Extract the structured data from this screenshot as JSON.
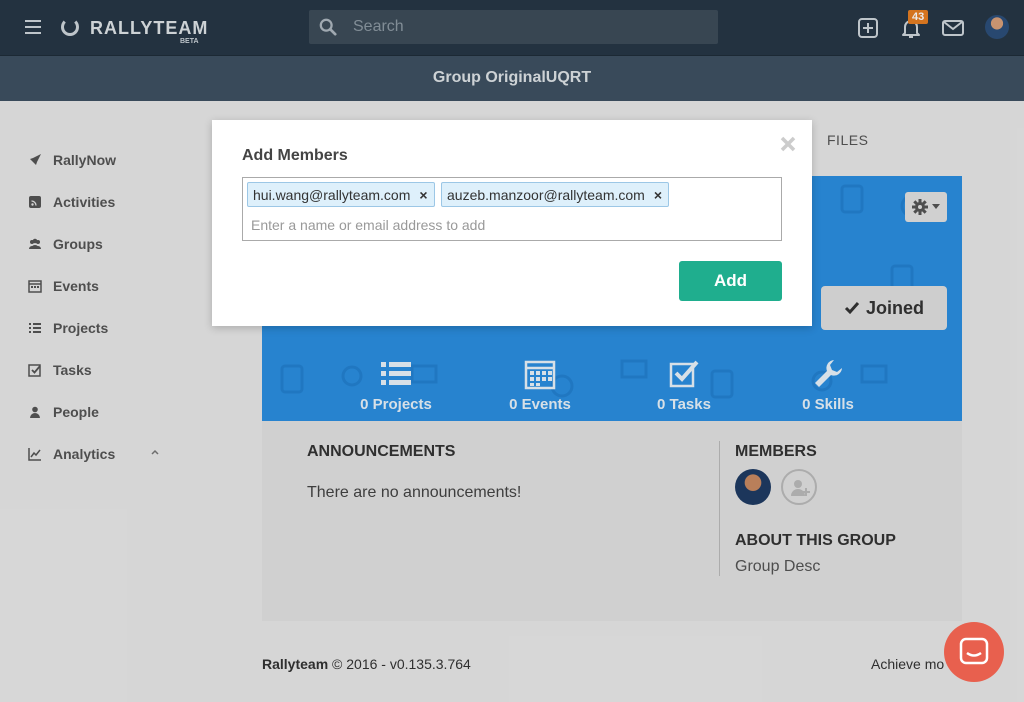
{
  "app": {
    "brand": "RALLYTEAM",
    "beta": "BETA"
  },
  "topnav": {
    "search_placeholder": "Search",
    "notification_count": "43",
    "icons": [
      "menu-icon",
      "plus-square-icon",
      "bell-icon",
      "envelope-icon"
    ]
  },
  "group": {
    "title": "Group OriginalUQRT"
  },
  "sidebar": {
    "items": [
      {
        "label": "RallyNow",
        "icon": "rocket-icon"
      },
      {
        "label": "Activities",
        "icon": "feed-icon"
      },
      {
        "label": "Groups",
        "icon": "users-icon"
      },
      {
        "label": "Events",
        "icon": "calendar-icon"
      },
      {
        "label": "Projects",
        "icon": "list-icon"
      },
      {
        "label": "Tasks",
        "icon": "checkbox-icon"
      },
      {
        "label": "People",
        "icon": "user-icon"
      },
      {
        "label": "Analytics",
        "icon": "chart-icon"
      }
    ]
  },
  "tabs": {
    "files": "FILES"
  },
  "cover": {
    "joined_label": "Joined",
    "stats": [
      {
        "label": "0 Projects",
        "icon": "list-icon"
      },
      {
        "label": "0 Events",
        "icon": "calendar-icon"
      },
      {
        "label": "0 Tasks",
        "icon": "checkbox-icon"
      },
      {
        "label": "0 Skills",
        "icon": "wrench-icon"
      }
    ],
    "bg_color": "#2b8fe1"
  },
  "content": {
    "announcements_title": "ANNOUNCEMENTS",
    "announcements_empty": "There are no announcements!",
    "members_title": "MEMBERS",
    "about_title": "ABOUT THIS GROUP",
    "about_desc": "Group Desc"
  },
  "footer": {
    "brand": "Rallyteam",
    "copyright": "© 2016 - v0.135.3.764",
    "right_text": "Achieve mo"
  },
  "modal": {
    "title": "Add Members",
    "tags": [
      "hui.wang@rallyteam.com",
      "auzeb.manzoor@rallyteam.com"
    ],
    "tag_remove": "×",
    "input_placeholder": "Enter a name or email address to add",
    "add_label": "Add",
    "accent": "#1fae8e"
  }
}
